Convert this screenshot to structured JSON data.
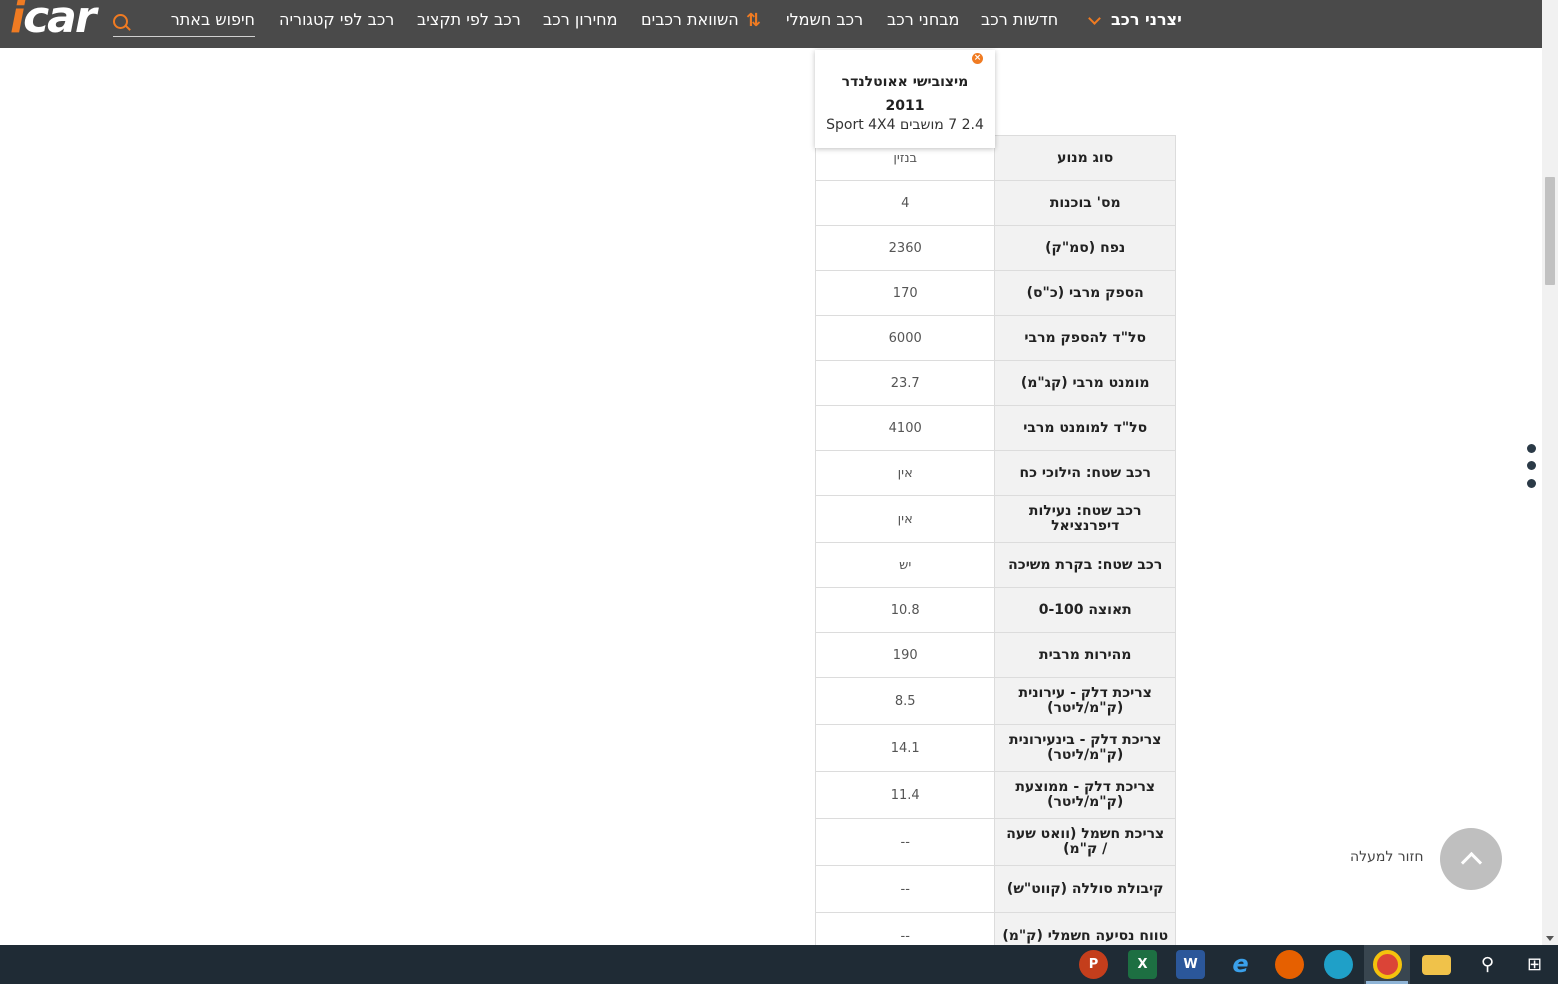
{
  "nav": {
    "logo": "icar",
    "search_label": "חיפוש באתר",
    "items": [
      {
        "label": "יצרני רכב",
        "bold": true
      },
      {
        "label": "חדשות רכב"
      },
      {
        "label": "מבחני רכב"
      },
      {
        "label": "רכב חשמלי"
      },
      {
        "label": "השוואת רכבים"
      },
      {
        "label": "מחירון רכב"
      },
      {
        "label": "רכב לפי תקציב"
      },
      {
        "label": "רכב לפי קטגוריה"
      }
    ]
  },
  "card": {
    "title_line1": "מיצובישי אאוטלנדר",
    "title_line2": "2011",
    "subtitle": "2.4 7 מושבים Sport 4X4"
  },
  "specs": [
    {
      "label": "סוג מנוע",
      "value": "בנזין"
    },
    {
      "label": "מס' בוכנות",
      "value": "4"
    },
    {
      "label": "נפח (סמ\"ק)",
      "value": "2360"
    },
    {
      "label": "הספק מרבי (כ\"ס)",
      "value": "170"
    },
    {
      "label": "סל\"ד להספק מרבי",
      "value": "6000"
    },
    {
      "label": "מומנט מרבי (קג\"מ)",
      "value": "23.7"
    },
    {
      "label": "סל\"ד למומנט מרבי",
      "value": "4100"
    },
    {
      "label": "רכב שטח: הילוכי כח",
      "value": "אין"
    },
    {
      "label": "רכב שטח: נעילות דיפרנציאל",
      "value": "אין"
    },
    {
      "label": "רכב שטח: בקרת משיכה",
      "value": "יש"
    },
    {
      "label": "תאוצה 0-100",
      "value": "10.8"
    },
    {
      "label": "מהירות מרבית",
      "value": "190"
    },
    {
      "label": "צריכת דלק - עירונית (ק\"מ/ליטר)",
      "value": "8.5"
    },
    {
      "label": "צריכת דלק - בינעירונית (ק\"מ/ליטר)",
      "value": "14.1"
    },
    {
      "label": "צריכת דלק - ממוצעת (ק\"מ/ליטר)",
      "value": "11.4"
    },
    {
      "label": "צריכת חשמל (וואט שעה / ק\"מ)",
      "value": "--"
    },
    {
      "label": "קיבולת סוללה (קווט\"ש)",
      "value": "--"
    },
    {
      "label": "טווח נסיעה חשמלי (ק\"מ)",
      "value": "--"
    }
  ],
  "back_to_top": "חזור למעלה",
  "taskbar": {
    "apps": [
      "powerpoint-icon",
      "excel-icon",
      "word-icon",
      "internet-explorer-icon",
      "firefox-icon",
      "edge-icon",
      "chrome-icon",
      "file-explorer-icon",
      "search-icon",
      "windows-start-icon"
    ]
  }
}
